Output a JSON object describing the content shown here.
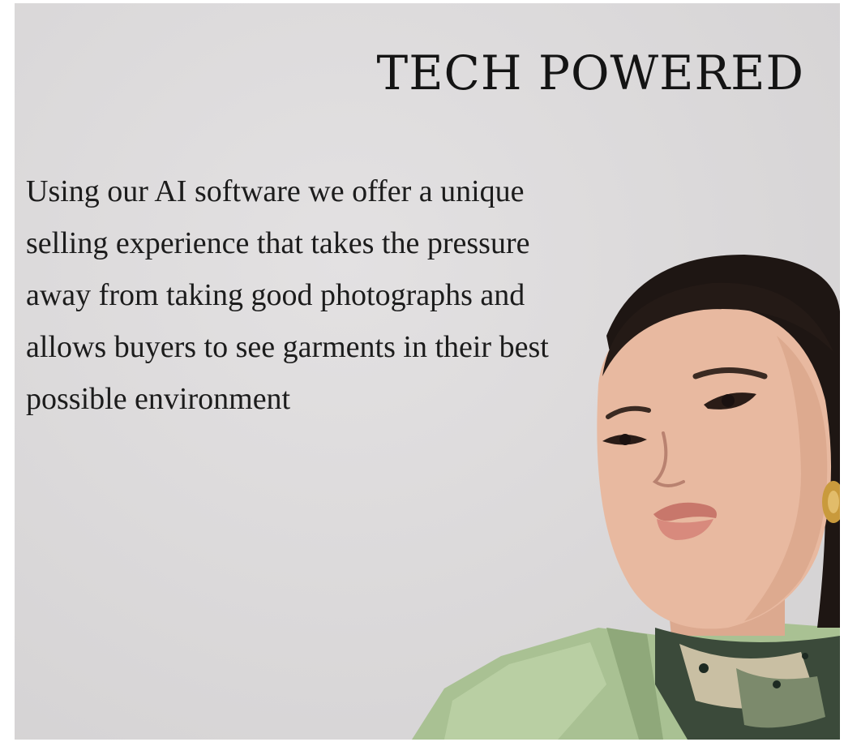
{
  "hero": {
    "headline": "TECH POWERED",
    "body": "Using our AI software we offer a unique selling experience that takes the pressure away from taking good photographs and allows buyers to see garments in their best possible environment"
  },
  "colors": {
    "background": "#dcdadb",
    "text": "#141414",
    "skin": "#e8b9a0",
    "hair": "#1e1613",
    "jacket": "#a9c193",
    "lips": "#c8776b",
    "earring": "#c99a3c"
  },
  "icons": {
    "photo": "model-portrait-photo"
  }
}
